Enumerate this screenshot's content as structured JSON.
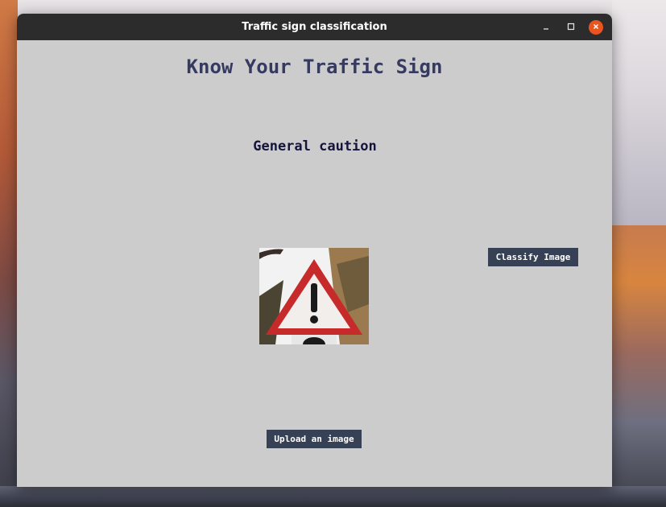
{
  "window": {
    "title": "Traffic sign classification",
    "controls": {
      "minimize_icon": "minimize-icon",
      "maximize_icon": "maximize-icon",
      "close_icon": "close-icon",
      "close_color": "#e9541f"
    }
  },
  "app": {
    "heading": "Know Your Traffic Sign",
    "result": "General caution",
    "image_subject": "General caution warning triangle sign",
    "classify_label": "Classify Image",
    "upload_label": "Upload an image"
  },
  "colors": {
    "window_bg": "#cccccc",
    "titlebar_bg": "#2c2c2c",
    "heading_color": "#363a60",
    "result_color": "#14143c",
    "button_bg": "#364156",
    "button_text": "#ffffff"
  }
}
